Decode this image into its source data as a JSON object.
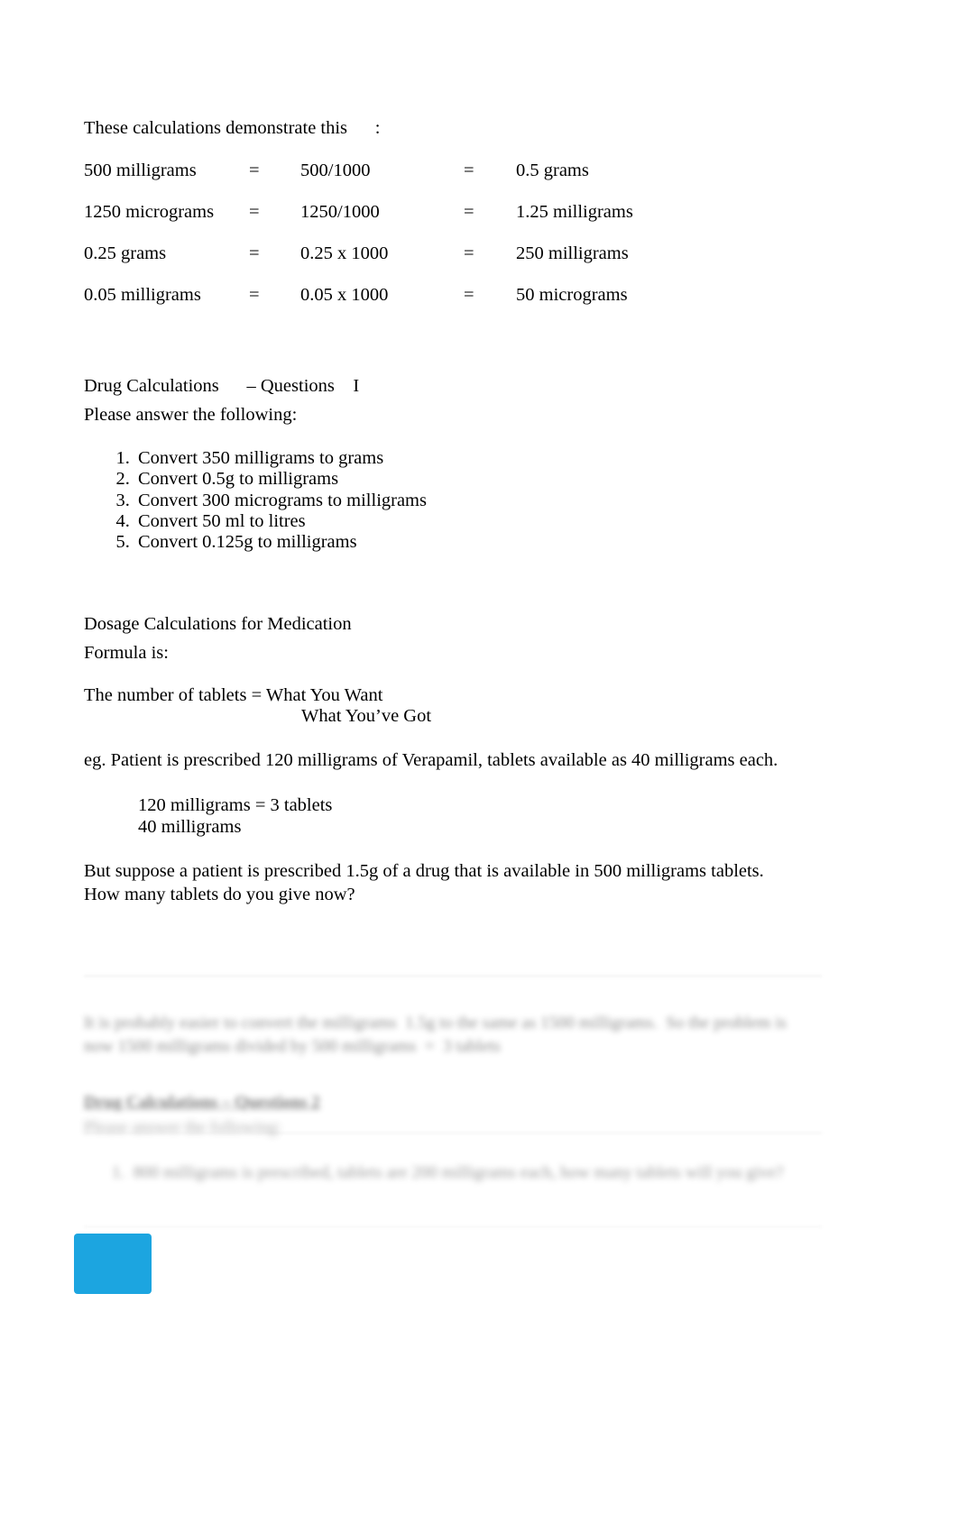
{
  "document": {
    "intro_line": "These calculations demonstrate this      :",
    "conversions": [
      {
        "from": "500 milligrams",
        "eq1": "=",
        "work": "500/1000",
        "eq2": "=",
        "to": "0.5 grams"
      },
      {
        "from": "1250 micrograms",
        "eq1": "=",
        "work": "1250/1000",
        "eq2": "=",
        "to": "1.25 milligrams"
      },
      {
        "from": "0.25 grams",
        "eq1": "=",
        "work": "0.25 x 1000",
        "eq2": "=",
        "to": "250 milligrams"
      },
      {
        "from": "0.05 milligrams",
        "eq1": "=",
        "work": "0.05 x 1000",
        "eq2": "=",
        "to": "50 micrograms"
      }
    ],
    "questions_heading": "Drug Calculations      – Questions    I",
    "questions_instruction": "Please answer the following:",
    "questions": [
      "Convert 350 milligrams to grams",
      "Convert 0.5g to milligrams",
      "Convert 300 micrograms to milligrams",
      "Convert 50 ml to litres",
      "Convert 0.125g to milligrams"
    ],
    "dosage_heading": "Dosage Calculations for Medication",
    "formula_label": "Formula is:",
    "formula_numerator": "The number of tablets = What You Want",
    "formula_denominator": "What You’ve Got",
    "example_paragraph": "eg. Patient is prescribed 120 milligrams of Verapamil, tablets available as 40 milligrams each.",
    "example_calc_line_1": "120 milligrams = 3 tablets",
    "example_calc_line_2": "40 milligrams",
    "closing_paragraph": "But suppose a patient is prescribed 1.5g of a drug that is available in 500 milligrams tablets. How many tablets do you give now?"
  },
  "faded_page": {
    "blurred_paragraph": "It is probably easier to convert the milligrams  1.5g to the same as 1500 milligrams.  So the problem is now 1500 milligrams divided by 500 milligrams  =  3 tablets",
    "blurred_heading": "Drug Calculations – Questions 2",
    "blurred_subline": "Please answer the following:",
    "blurred_list_item": "1.  800 milligrams is prescribed, tablets are 200 milligrams each, how many tablets will you give?"
  },
  "colors": {
    "blue_box": "#1CA5E0",
    "text": "#000000",
    "hairline": "#c9c9c9"
  }
}
